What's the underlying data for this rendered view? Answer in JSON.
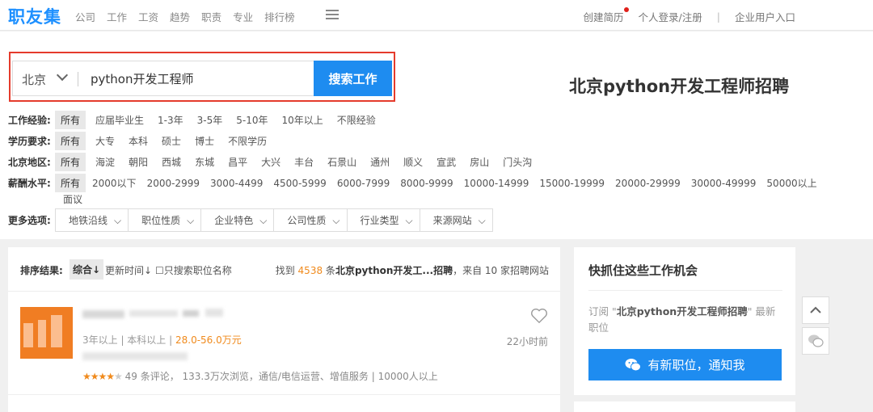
{
  "brand": {
    "logo": "职友集",
    "color": "#1e8cf0"
  },
  "nav": {
    "items": [
      "公司",
      "工作",
      "工资",
      "趋势",
      "职责",
      "专业",
      "排行榜"
    ],
    "menu_icon": "menu-icon"
  },
  "topright": {
    "resume": "创建简历",
    "login": "个人登录/注册",
    "separator": "|",
    "enterprise": "企业用户入口"
  },
  "search": {
    "city": "北京",
    "query": "python开发工程师",
    "button": "搜索工作"
  },
  "page_heading": "北京python开发工程师招聘",
  "filters": {
    "experience": {
      "label": "工作经验:",
      "options": [
        "所有",
        "应届毕业生",
        "1-3年",
        "3-5年",
        "5-10年",
        "10年以上",
        "不限经验"
      ]
    },
    "education": {
      "label": "学历要求:",
      "options": [
        "所有",
        "大专",
        "本科",
        "硕士",
        "博士",
        "不限学历"
      ]
    },
    "district": {
      "label": "北京地区:",
      "options": [
        "所有",
        "海淀",
        "朝阳",
        "西城",
        "东城",
        "昌平",
        "大兴",
        "丰台",
        "石景山",
        "通州",
        "顺义",
        "宣武",
        "房山",
        "门头沟"
      ]
    },
    "salary": {
      "label": "薪酬水平:",
      "options": [
        "所有",
        "2000以下",
        "2000-2999",
        "3000-4499",
        "4500-5999",
        "6000-7999",
        "8000-9999",
        "10000-14999",
        "15000-19999",
        "20000-29999",
        "30000-49999",
        "50000以上"
      ],
      "extra": "面议"
    },
    "more": {
      "label": "更多选项:",
      "options": [
        "地铁沿线",
        "职位性质",
        "企业特色",
        "公司性质",
        "行业类型",
        "来源网站"
      ]
    }
  },
  "results": {
    "sort_label": "排序结果:",
    "sort_selected": "综合↓",
    "sort_time": "更新时间↓",
    "only_title": "只搜索职位名称",
    "count_prefix": "找到",
    "count_number": "4538",
    "count_middle": "条",
    "count_keyword": "北京python开发工...招聘",
    "count_suffix": "，来自 10 家招聘网站"
  },
  "job": {
    "meta": "3年以上 | 本科以上 | ",
    "salary": "28.0-56.0万元",
    "ago": "22小时前",
    "rating_stars": 4,
    "rating_text": "49 条评论， 133.3万次浏览，通信/电信运营、增值服务 | 10000人以上"
  },
  "side": {
    "title": "快抓住这些工作机会",
    "desc_prefix": "订阅 \"",
    "desc_keyword": "北京python开发工程师招聘",
    "desc_suffix": "\" 最新职位",
    "button": "有新职位，通知我",
    "button_icon": "wechat-icon"
  },
  "float": {
    "up_icon": "chevron-up-icon",
    "chat_icon": "chat-icon"
  },
  "colors": {
    "accent": "#1e8cf0",
    "highlight": "#e53b2c",
    "salary": "#f08a1c"
  }
}
